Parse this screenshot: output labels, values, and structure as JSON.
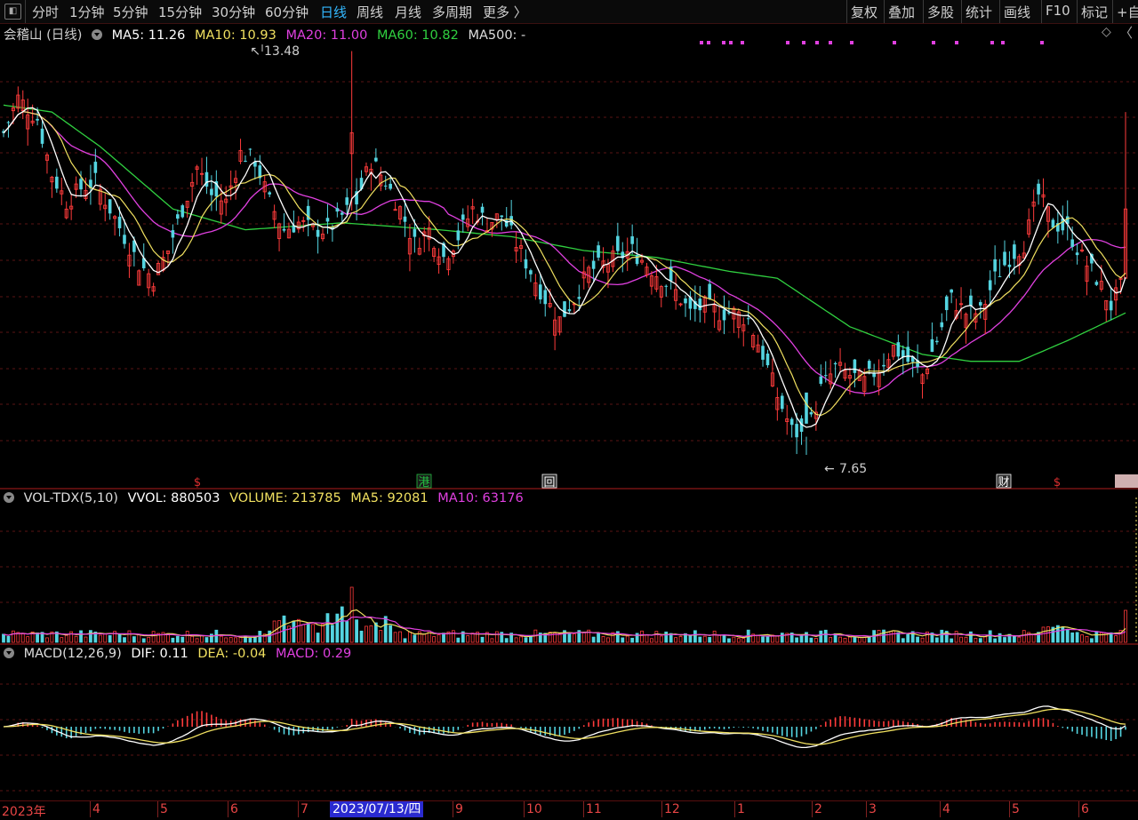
{
  "toolbar": {
    "items": [
      "分时",
      "1分钟",
      "5分钟",
      "15分钟",
      "30分钟",
      "60分钟",
      "日线",
      "周线",
      "月线",
      "多周期",
      "更多 〉"
    ],
    "active": "日线",
    "right_items": [
      "复权",
      "叠加",
      "多股",
      "统计",
      "画线",
      "F10",
      "标记",
      "+自"
    ]
  },
  "main_info": {
    "stock": "会稽山 (日线)",
    "ma5": "MA5: 11.26",
    "ma10": "MA10: 10.93",
    "ma20": "MA20: 11.00",
    "ma60": "MA60: 10.82",
    "ma500": "MA500: -"
  },
  "annotations": {
    "high": "13.48",
    "low": "7.65"
  },
  "event_markers": [
    {
      "text": "$",
      "color": "#e03030"
    },
    {
      "text": "港",
      "color": "#22c040"
    },
    {
      "text": "回",
      "color": "#ffffff"
    },
    {
      "text": "财",
      "color": "#ffffff"
    },
    {
      "text": "$",
      "color": "#e03030"
    }
  ],
  "vol_info": {
    "name": "VOL-TDX(5,10)",
    "vvol": "VVOL: 880503",
    "volume": "VOLUME: 213785",
    "ma5": "MA5: 92081",
    "ma10": "MA10: 63176"
  },
  "macd_info": {
    "name": "MACD(12,26,9)",
    "dif": "DIF: 0.11",
    "dea": "DEA: -0.04",
    "macd": "MACD: 0.29"
  },
  "date_axis": {
    "labels": [
      "2023年",
      "4",
      "5",
      "6",
      "7",
      "9",
      "10",
      "11",
      "12",
      "1",
      "2",
      "3",
      "4",
      "5",
      "6"
    ],
    "selected": "2023/07/13/四"
  },
  "colors": {
    "up": "#ff3b3b",
    "down": "#54d4e0",
    "ma5": "#ffffff",
    "ma10": "#f0e060",
    "ma20": "#e040e0",
    "ma60": "#30d040",
    "dea": "#f0e060"
  },
  "chart_data": {
    "type": "candlestick",
    "price_range": {
      "high": 13.48,
      "low": 7.65
    },
    "close_path": [
      [
        0,
        12.3
      ],
      [
        3,
        12.8
      ],
      [
        7,
        12.5
      ],
      [
        10,
        11.7
      ],
      [
        13,
        11.3
      ],
      [
        16,
        11.5
      ],
      [
        19,
        11.6
      ],
      [
        22,
        11.2
      ],
      [
        25,
        10.8
      ],
      [
        28,
        10.4
      ],
      [
        31,
        10.2
      ],
      [
        34,
        10.6
      ],
      [
        37,
        11.2
      ],
      [
        40,
        11.8
      ],
      [
        43,
        11.4
      ],
      [
        46,
        11.3
      ],
      [
        49,
        12.0
      ],
      [
        52,
        11.9
      ],
      [
        55,
        11.3
      ],
      [
        58,
        10.9
      ],
      [
        61,
        11.0
      ],
      [
        64,
        10.9
      ],
      [
        67,
        10.9
      ],
      [
        70,
        11.1
      ],
      [
        73,
        11.3
      ],
      [
        76,
        11.9
      ],
      [
        79,
        11.6
      ],
      [
        82,
        11.2
      ],
      [
        85,
        10.7
      ],
      [
        88,
        10.9
      ],
      [
        91,
        10.5
      ],
      [
        94,
        10.8
      ],
      [
        97,
        11.2
      ],
      [
        100,
        11.0
      ],
      [
        103,
        11.1
      ],
      [
        106,
        10.7
      ],
      [
        109,
        10.3
      ],
      [
        112,
        9.9
      ],
      [
        115,
        9.6
      ],
      [
        118,
        9.9
      ],
      [
        121,
        10.3
      ],
      [
        124,
        10.4
      ],
      [
        127,
        10.5
      ],
      [
        130,
        10.6
      ],
      [
        133,
        10.4
      ],
      [
        136,
        10.2
      ],
      [
        139,
        10.0
      ],
      [
        142,
        9.7
      ],
      [
        145,
        9.8
      ],
      [
        148,
        9.7
      ],
      [
        151,
        9.7
      ],
      [
        154,
        9.6
      ],
      [
        157,
        9.1
      ],
      [
        160,
        8.5
      ],
      [
        163,
        8.0
      ],
      [
        166,
        7.9
      ],
      [
        169,
        8.6
      ],
      [
        172,
        8.9
      ],
      [
        175,
        8.8
      ],
      [
        178,
        8.7
      ],
      [
        181,
        8.9
      ],
      [
        184,
        9.2
      ],
      [
        187,
        9.0
      ],
      [
        190,
        8.8
      ],
      [
        193,
        9.3
      ],
      [
        196,
        9.9
      ],
      [
        199,
        9.7
      ],
      [
        202,
        9.7
      ],
      [
        205,
        10.2
      ],
      [
        208,
        10.5
      ],
      [
        211,
        10.7
      ],
      [
        214,
        11.4
      ],
      [
        217,
        11.0
      ],
      [
        220,
        10.9
      ],
      [
        223,
        10.5
      ],
      [
        226,
        10.2
      ],
      [
        229,
        9.8
      ],
      [
        232,
        10.2
      ]
    ],
    "ma60_path": [
      [
        0,
        12.7
      ],
      [
        10,
        12.6
      ],
      [
        20,
        12.1
      ],
      [
        35,
        11.2
      ],
      [
        50,
        10.9
      ],
      [
        70,
        11.0
      ],
      [
        90,
        10.9
      ],
      [
        105,
        10.8
      ],
      [
        120,
        10.6
      ],
      [
        135,
        10.5
      ],
      [
        150,
        10.3
      ],
      [
        160,
        10.2
      ],
      [
        175,
        9.5
      ],
      [
        190,
        9.1
      ],
      [
        200,
        9.0
      ],
      [
        210,
        9.0
      ],
      [
        220,
        9.3
      ],
      [
        232,
        9.7
      ]
    ],
    "volume": {
      "vvol": 880503,
      "volume": 213785,
      "ma5": 92081,
      "ma10": 63176
    },
    "macd": {
      "dif": 0.11,
      "dea": -0.04,
      "macd": 0.29
    }
  }
}
